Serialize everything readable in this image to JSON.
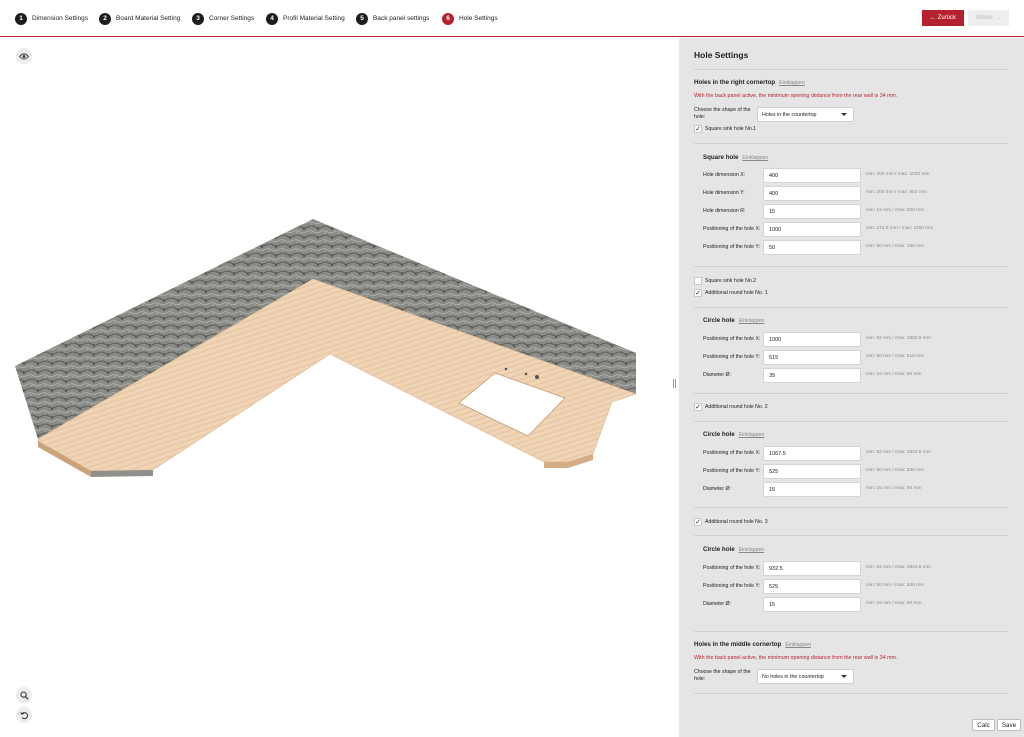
{
  "steps": [
    {
      "num": "1",
      "label": "Dimension Settings"
    },
    {
      "num": "2",
      "label": "Board Material Setting"
    },
    {
      "num": "3",
      "label": "Corner Settings"
    },
    {
      "num": "4",
      "label": "Profil Material Setting"
    },
    {
      "num": "5",
      "label": "Back panel settings"
    },
    {
      "num": "6",
      "label": "Hole Settings"
    }
  ],
  "nav": {
    "back_label": "← Zurück",
    "next_label": "Weiter →"
  },
  "colors": {
    "accent": "#b5222f",
    "panel_bg": "#e5e5e5"
  },
  "viewer": {
    "eye_icon": "eye-icon",
    "zoom_icon": "magnifier-icon",
    "reset_icon": "rotate-reset-icon"
  },
  "panel": {
    "title": "Hole Settings",
    "right": {
      "title": "Holes in the right cornertop",
      "collapse": "Einklappen",
      "warning": "With the back panel active, the minimum opening distance from the rear wall is 34 mm.",
      "shape_label": "Choose the shape of the hole:",
      "shape_value": "Holes in the countertop",
      "sq1_label": "Square sink hole No.1",
      "square": {
        "title": "Square hole",
        "collapse": "Einklappen",
        "rows": [
          {
            "label": "Hole dimension X:",
            "value": "400",
            "hint": "min: 200 mm / max: 1030 mm"
          },
          {
            "label": "Hole dimension Y:",
            "value": "400",
            "hint": "min: 200 mm / max: 502 mm"
          },
          {
            "label": "Hole dimension R:",
            "value": "15",
            "hint": "min: 15 mm / max: 200 mm"
          },
          {
            "label": "Positioning of the hole X:",
            "value": "1000",
            "hint": "min: 274.5 mm / max: 1150 mm"
          },
          {
            "label": "Positioning of the hole Y:",
            "value": "50",
            "hint": "min: 50 mm / max: 150 mm"
          }
        ]
      },
      "sq2_label": "Square sink hole No.2",
      "round1_label": "Additional round hole No. 1",
      "circle1": {
        "title": "Circle hole",
        "collapse": "Einklappen",
        "rows": [
          {
            "label": "Positioning of the hole X:",
            "value": "1000",
            "hint": "min: 82 mm / max: 1852.5 mm"
          },
          {
            "label": "Positioning of the hole Y:",
            "value": "515",
            "hint": "min: 50 mm / max: 515 mm"
          },
          {
            "label": "Diameter Ø:",
            "value": "35",
            "hint": "min: 15 mm / max: 50 mm"
          }
        ]
      },
      "round2_label": "Additional round hole No. 2",
      "circle2": {
        "title": "Circle hole",
        "collapse": "Einklappen",
        "rows": [
          {
            "label": "Positioning of the hole X:",
            "value": "1067.5",
            "hint": "min: 82 mm / max: 1842.5 mm"
          },
          {
            "label": "Positioning of the hole Y:",
            "value": "525",
            "hint": "min: 50 mm / max: 530 mm"
          },
          {
            "label": "Diameter Ø:",
            "value": "15",
            "hint": "min: 15 mm / max: 50 mm"
          }
        ]
      },
      "round3_label": "Additional round hole No. 3",
      "circle3": {
        "title": "Circle hole",
        "collapse": "Einklappen",
        "rows": [
          {
            "label": "Positioning of the hole X:",
            "value": "932.5",
            "hint": "min: 82 mm / max: 1842.5 mm"
          },
          {
            "label": "Positioning of the hole Y:",
            "value": "525",
            "hint": "min: 50 mm / max: 530 mm"
          },
          {
            "label": "Diameter Ø:",
            "value": "15",
            "hint": "min: 15 mm / max: 50 mm"
          }
        ]
      }
    },
    "middle": {
      "title": "Holes in the middle cornertop",
      "collapse": "Einklappen",
      "warning": "With the back panel active, the minimum opening distance from the rear wall is 34 mm.",
      "shape_label": "Choose the shape of the hole:",
      "shape_value": "No holes in the countertop"
    }
  },
  "footer": {
    "calc_label": "Calc",
    "save_label": "Save"
  }
}
